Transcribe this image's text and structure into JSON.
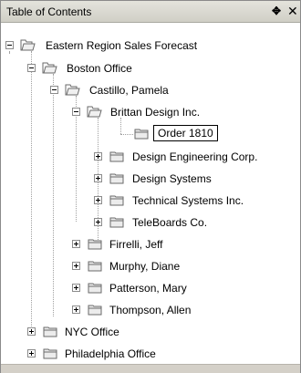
{
  "panel": {
    "title": "Table of Contents",
    "pin_glyph": "✥",
    "close_glyph": "✕"
  },
  "tree": {
    "root": "Eastern Region Sales Forecast",
    "boston": "Boston Office",
    "castillo": "Castillo, Pamela",
    "brittan": "Brittan Design Inc.",
    "order": "Order 1810",
    "design_eng": "Design Engineering Corp.",
    "design_sys": "Design Systems",
    "tech_sys": "Technical Systems Inc.",
    "teleboards": "TeleBoards Co.",
    "firrelli": "Firrelli, Jeff",
    "murphy": "Murphy, Diane",
    "patterson": "Patterson, Mary",
    "thompson": "Thompson, Allen",
    "nyc": "NYC Office",
    "philadelphia": "Philadelphia Office"
  }
}
